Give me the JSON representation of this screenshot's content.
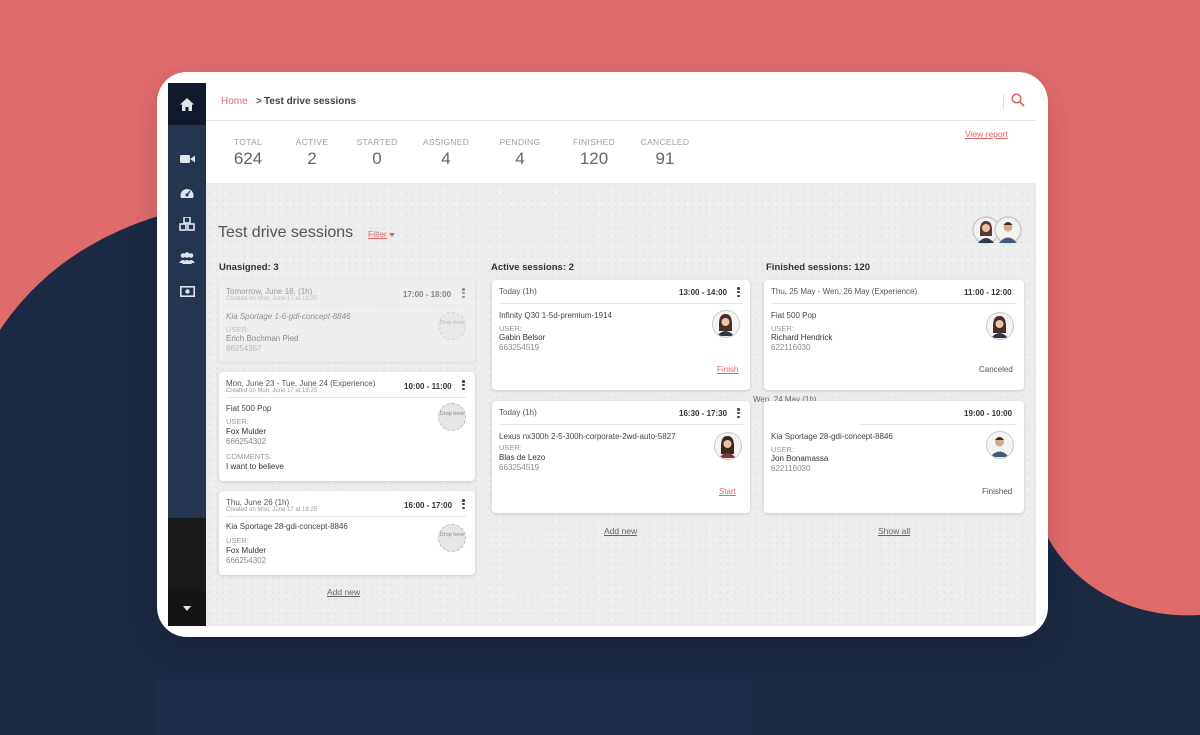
{
  "colors": {
    "accent": "#e06565",
    "sidebar": "#253550",
    "background_red": "#e06b6b",
    "background_navy": "#1b2942"
  },
  "sidebar": {
    "items": [
      {
        "icon": "home-icon"
      },
      {
        "icon": "video-icon"
      },
      {
        "icon": "dashboard-icon"
      },
      {
        "icon": "cubes-icon"
      },
      {
        "icon": "users-icon"
      },
      {
        "icon": "money-icon"
      }
    ],
    "toggle_icon": "caret-down-icon"
  },
  "breadcrumb": {
    "home": "Home",
    "separator": ">",
    "current": "Test drive sessions"
  },
  "stats": {
    "view_report": "View report",
    "items": [
      {
        "label": "TOTAL",
        "value": "624"
      },
      {
        "label": "ACTIVE",
        "value": "2"
      },
      {
        "label": "STARTED",
        "value": "0"
      },
      {
        "label": "ASSIGNED",
        "value": "4"
      },
      {
        "label": "PENDING",
        "value": "4"
      },
      {
        "label": "FINISHED",
        "value": "120"
      },
      {
        "label": "CANCELED",
        "value": "91"
      }
    ]
  },
  "board": {
    "title": "Test drive sessions",
    "filter": "Filter",
    "columns": {
      "unassigned": {
        "title": "Unasigned: 3",
        "add_new": "Add new",
        "cards": [
          {
            "date": "Tomorrow, June 18, (1h)",
            "created": "Created on Mon, June 17 at 19:25",
            "time": "17:00 - 18:00",
            "car": "Kia Sportage 1-6-gdi-concept-8846",
            "user_label": "USER:",
            "user": "Erich Bochman Pied",
            "phone": "66254357",
            "drop_label": "Drop here"
          },
          {
            "date": "Mon, June 23 - Tue, June 24 (Experience)",
            "created": "Created on Mon, June 17 at 19:25",
            "time": "10:00 - 11:00",
            "car": "Fiat 500 Pop",
            "user_label": "USER:",
            "user": "Fox Mulder",
            "phone": "666254302",
            "comments_label": "COMMENTS:",
            "comments": "I want to believe",
            "drop_label": "Drop here"
          },
          {
            "date": "Thu, June 26 (1h)",
            "created": "Created on Mon, June 17 at 19:25",
            "time": "16:00 - 17:00",
            "car": "Kia Sportage 28-gdi-concept-8846",
            "user_label": "USER:",
            "user": "Fox Mulder",
            "phone": "666254302",
            "drop_label": "Drop here"
          }
        ]
      },
      "active": {
        "title": "Active sessions: 2",
        "add_new": "Add new",
        "cards": [
          {
            "date": "Today (1h)",
            "time": "13:00 - 14:00",
            "car": "Infinity Q30 1-5d-premium-1914",
            "user_label": "USER:",
            "user": "Gabin Belsor",
            "phone": "663254519",
            "action": "Finish"
          },
          {
            "date": "Today (1h)",
            "time": "16:30 - 17:30",
            "car": "Lexus nx300h 2-5-300h-corporate-2wd-auto-5827",
            "user_label": "USER:",
            "user": "Blas de Lezo",
            "phone": "663254519",
            "action": "Start"
          }
        ]
      },
      "finished": {
        "title": "Finished sessions: 120",
        "show_all": "Show all",
        "day_separator": "Wen, 24 May (1h)",
        "cards": [
          {
            "date": "Thu, 25 May - Wen, 26 May (Experience)",
            "time": "11:00 - 12:00",
            "car": "Fiat 500 Pop",
            "user_label": "USER:",
            "user": "Richard Hendrick",
            "phone": "622116030",
            "status": "Canceled"
          },
          {
            "time": "19:00 - 10:00",
            "car": "Kia Sportage 28-gdi-concept-8846",
            "user_label": "USER:",
            "user": "Jon Bonamassa",
            "phone": "622116030",
            "status": "Finished"
          }
        ]
      }
    }
  }
}
